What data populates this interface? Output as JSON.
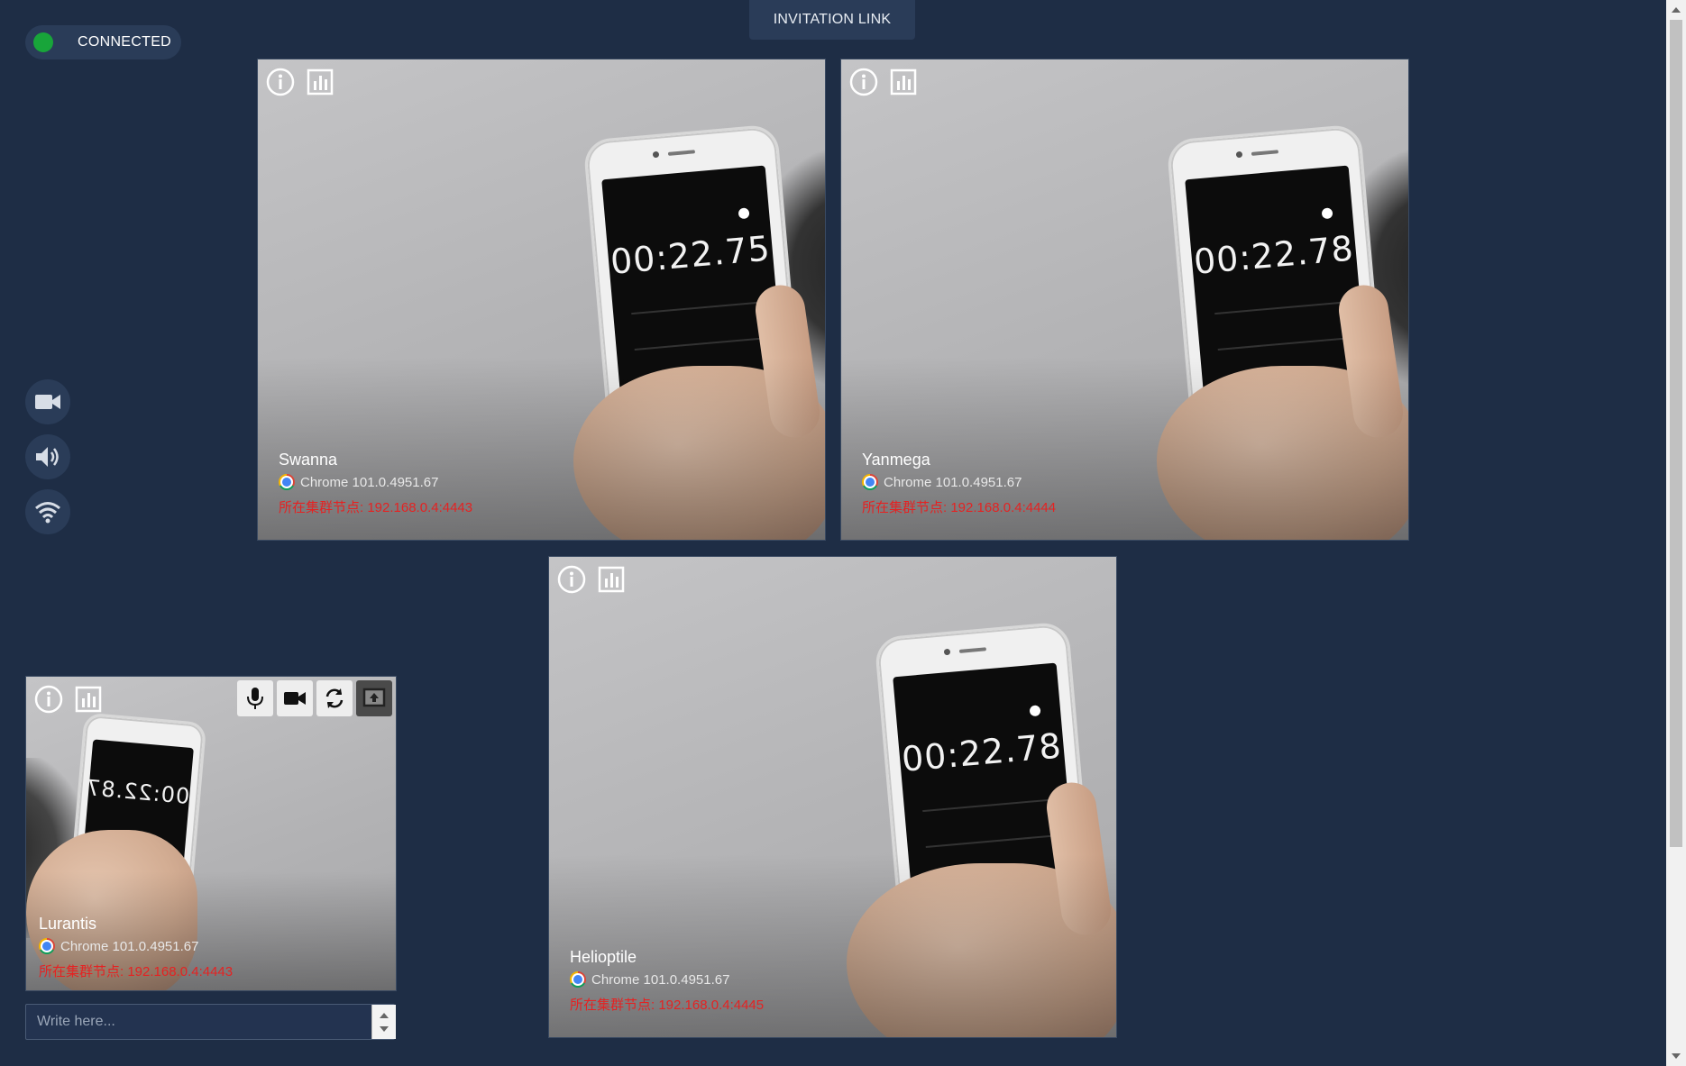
{
  "status": {
    "label": "CONNECTED",
    "color": "#18a53a"
  },
  "header": {
    "invite_label": "INVITATION LINK"
  },
  "sidebar": {
    "buttons": [
      {
        "icon": "video-camera-icon"
      },
      {
        "icon": "speaker-icon"
      },
      {
        "icon": "wifi-icon"
      }
    ]
  },
  "tiles": [
    {
      "name": "Swanna",
      "browser": "Chrome 101.0.4951.67",
      "node": "所在集群节点: 192.168.0.4:4443",
      "stopwatch": "00:22.75"
    },
    {
      "name": "Yanmega",
      "browser": "Chrome 101.0.4951.67",
      "node": "所在集群节点: 192.168.0.4:4444",
      "stopwatch": "00:22.78"
    },
    {
      "name": "Helioptile",
      "browser": "Chrome 101.0.4951.67",
      "node": "所在集群节点: 192.168.0.4:4445",
      "stopwatch": "00:22.78"
    }
  ],
  "local": {
    "name": "Lurantis",
    "browser": "Chrome 101.0.4951.67",
    "node": "所在集群节点: 192.168.0.4:4443",
    "stopwatch": "00:22.87"
  },
  "chat": {
    "placeholder": "Write here..."
  },
  "colors": {
    "background": "#1e2d45",
    "panel": "#2a3c58",
    "node_text": "#e52222"
  }
}
